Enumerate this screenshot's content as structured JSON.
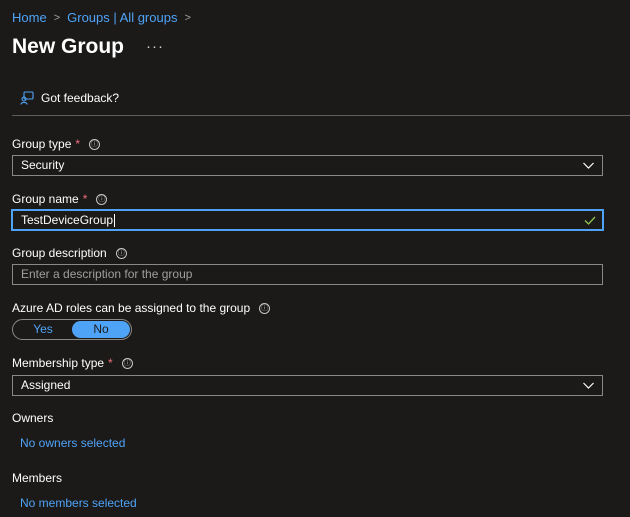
{
  "breadcrumb": {
    "items": [
      "Home",
      "Groups | All groups"
    ]
  },
  "page": {
    "title": "New Group",
    "more": "···"
  },
  "feedback": {
    "label": "Got feedback?"
  },
  "form": {
    "group_type": {
      "label": "Group type",
      "required": "*",
      "value": "Security"
    },
    "group_name": {
      "label": "Group name",
      "required": "*",
      "value": "TestDeviceGroup"
    },
    "group_description": {
      "label": "Group description",
      "placeholder": "Enter a description for the group"
    },
    "azure_roles": {
      "label": "Azure AD roles can be assigned to the group",
      "yes": "Yes",
      "no": "No",
      "selected": "No"
    },
    "membership_type": {
      "label": "Membership type",
      "required": "*",
      "value": "Assigned"
    },
    "owners": {
      "label": "Owners",
      "link": "No owners selected"
    },
    "members": {
      "label": "Members",
      "link": "No members selected"
    }
  },
  "icons": {
    "info": "ⓘ",
    "chevron": "chevron-down-icon",
    "check": "checkmark-icon",
    "feedback": "feedback-person-icon"
  },
  "colors": {
    "accent": "#4fa3f7",
    "required": "#f1707b",
    "background": "#1b1a19",
    "valid": "#92c353"
  }
}
